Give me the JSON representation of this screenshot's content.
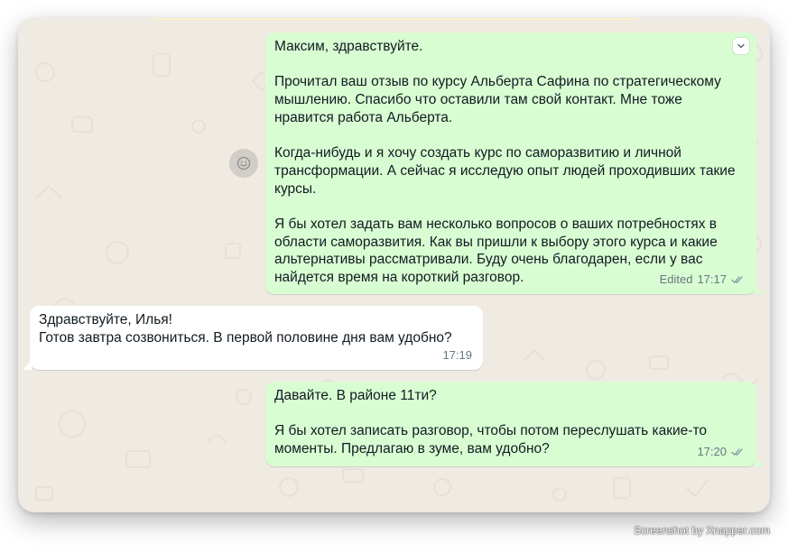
{
  "colors": {
    "chat_background": "#efeae2",
    "outgoing_bubble": "#d9fdd3",
    "incoming_bubble": "#ffffff",
    "meta_text": "#667781",
    "read_ticks": "#667781"
  },
  "messages": [
    {
      "direction": "outgoing",
      "paragraphs": [
        "Максим, здравствуйте.",
        "Прочитал ваш отзыв по курсу Альберта Сафина по стратегическому мышлению. Спасибо что оставили там свой контакт. Мне тоже нравится работа Альберта.",
        "Когда-нибудь и я хочу создать курс по саморазвитию и личной трансформации. А сейчас я исследую опыт людей проходивших такие курсы.",
        "Я бы хотел задать вам несколько вопросов о ваших потребностях в области саморазвития. Как вы пришли к выбору этого курса и какие альтернативы рассматривали. Буду очень благодарен, если у вас найдется время на короткий разговор."
      ],
      "edited_label": "Edited",
      "time": "17:17",
      "status_icon": "double-check-icon"
    },
    {
      "direction": "incoming",
      "paragraphs": [
        "Здравствуйте, Илья!\nГотов завтра созвониться. В первой половине дня вам удобно?"
      ],
      "time": "17:19"
    },
    {
      "direction": "outgoing",
      "paragraphs": [
        "Давайте. В районе 11ти?",
        "Я бы хотел записать разговор, чтобы потом переслушать какие-то моменты. Предлагаю в зуме, вам удобно?"
      ],
      "time": "17:20",
      "status_icon": "double-check-icon"
    }
  ],
  "icons": {
    "message_menu": "chevron-down-icon",
    "reaction": "emoji-reaction-icon"
  },
  "watermark": "Screenshot by Xnapper.com"
}
